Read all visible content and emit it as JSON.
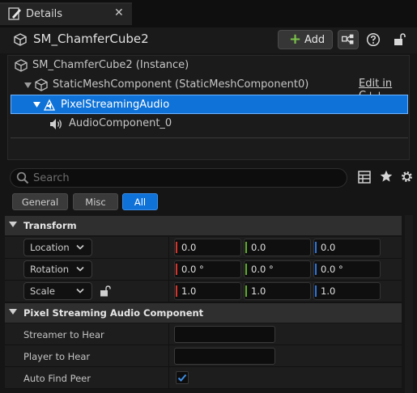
{
  "tab": {
    "title": "Details",
    "close": "✕"
  },
  "header": {
    "object_name": "SM_ChamferCube2",
    "add_label": "Add"
  },
  "tree": {
    "rows": [
      {
        "label": "SM_ChamferCube2 (Instance)"
      },
      {
        "label": "StaticMeshComponent (StaticMeshComponent0)",
        "action": "Edit in C++"
      },
      {
        "label": "PixelStreamingAudio",
        "selected": true
      },
      {
        "label": "AudioComponent_0"
      }
    ]
  },
  "search": {
    "placeholder": "Search"
  },
  "filters": [
    {
      "label": "General",
      "active": false
    },
    {
      "label": "Misc",
      "active": false
    },
    {
      "label": "All",
      "active": true
    }
  ],
  "transform": {
    "title": "Transform",
    "rows": [
      {
        "label": "Location",
        "x": "0.0",
        "y": "0.0",
        "z": "0.0"
      },
      {
        "label": "Rotation",
        "x": "0.0 °",
        "y": "0.0 °",
        "z": "0.0 °"
      },
      {
        "label": "Scale",
        "x": "1.0",
        "y": "1.0",
        "z": "1.0"
      }
    ]
  },
  "audio": {
    "title": "Pixel Streaming Audio Component",
    "rows": [
      {
        "label": "Streamer to Hear",
        "value": ""
      },
      {
        "label": "Player to Hear",
        "value": ""
      },
      {
        "label": "Auto Find Peer",
        "checked": true
      }
    ]
  },
  "colors": {
    "accent": "#0e72d8",
    "axis_x": "#d9342b",
    "axis_y": "#5fae2a",
    "axis_z": "#2f74d8",
    "add_plus": "#7cc44a"
  }
}
